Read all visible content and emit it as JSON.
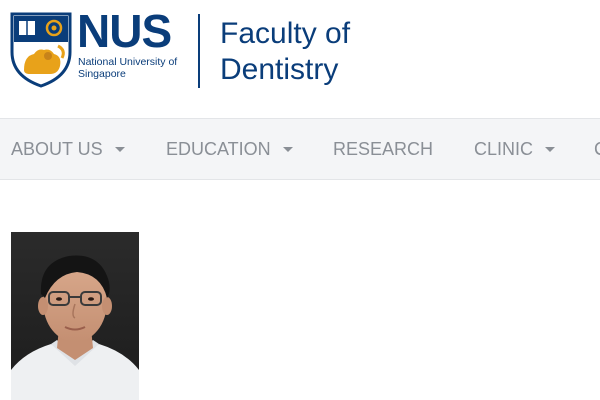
{
  "header": {
    "logo_text": "NUS",
    "university_name": "National University of Singapore",
    "faculty_line1": "Faculty of",
    "faculty_line2": "Dentistry"
  },
  "nav": {
    "items": [
      {
        "label": "ABOUT US",
        "has_dropdown": true
      },
      {
        "label": "EDUCATION",
        "has_dropdown": true
      },
      {
        "label": "RESEARCH",
        "has_dropdown": false
      },
      {
        "label": "CLINIC",
        "has_dropdown": true
      },
      {
        "label": "C",
        "has_dropdown": false
      }
    ]
  },
  "profile": {
    "photo": "staff-portrait-photo"
  },
  "colors": {
    "brand_blue": "#0a3d7a",
    "nav_background": "#f4f5f7",
    "nav_text": "#8a8f96"
  }
}
